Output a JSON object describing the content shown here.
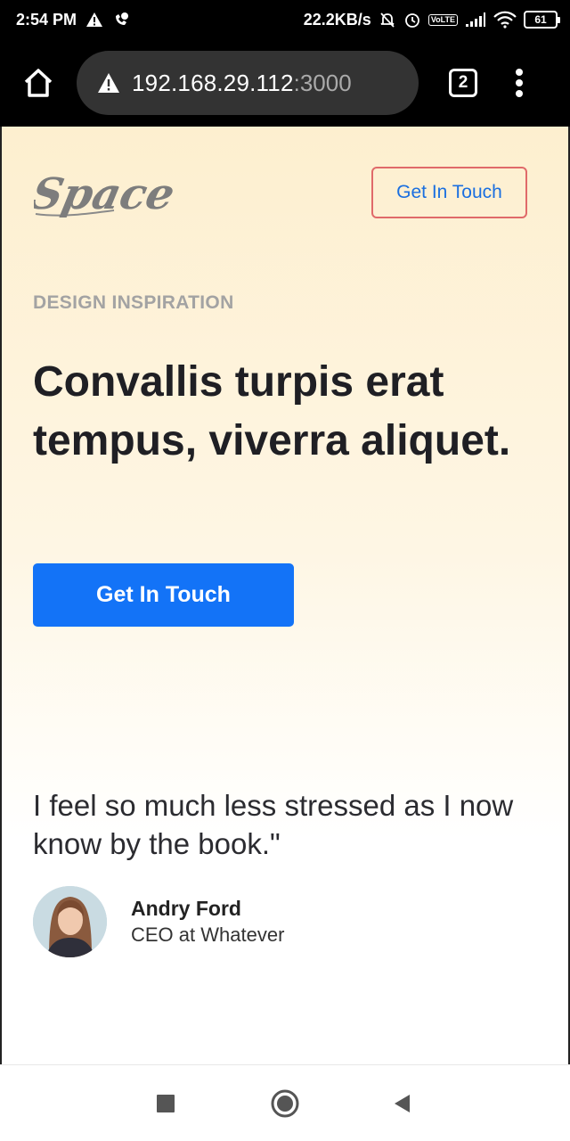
{
  "status_bar": {
    "time": "2:54 PM",
    "network_speed": "22.2KB/s",
    "volte_top": "Vo",
    "volte_bottom": "LTE",
    "battery": "61",
    "icons": [
      "alert-triangle-icon",
      "call-forward-icon",
      "mute-bell-icon",
      "alarm-icon",
      "volte-icon",
      "signal-icon",
      "wifi-icon",
      "battery-icon"
    ]
  },
  "browser": {
    "url_host": "192.168.29.112",
    "url_port": ":3000",
    "tab_count": "2",
    "icons": [
      "home-icon",
      "not-secure-warning-icon",
      "tabs-icon",
      "more-menu-icon"
    ]
  },
  "page": {
    "logo_text": "Space",
    "header_cta_label": "Get In Touch",
    "eyebrow": "DESIGN INSPIRATION",
    "hero_title": "Convallis turpis erat tempus, viverra aliquet.",
    "hero_cta_label": "Get In Touch",
    "quote": "I feel so much less stressed as I now know by the book.\"",
    "author": {
      "name": "Andry Ford",
      "role": "CEO at Whatever"
    }
  },
  "colors": {
    "accent_blue": "#1373f7",
    "header_cta_border": "#e06a6a",
    "hero_bg_top": "#fdefcf"
  },
  "nav_bar": {
    "icons": [
      "recents-square-icon",
      "home-circle-icon",
      "back-triangle-icon"
    ]
  }
}
